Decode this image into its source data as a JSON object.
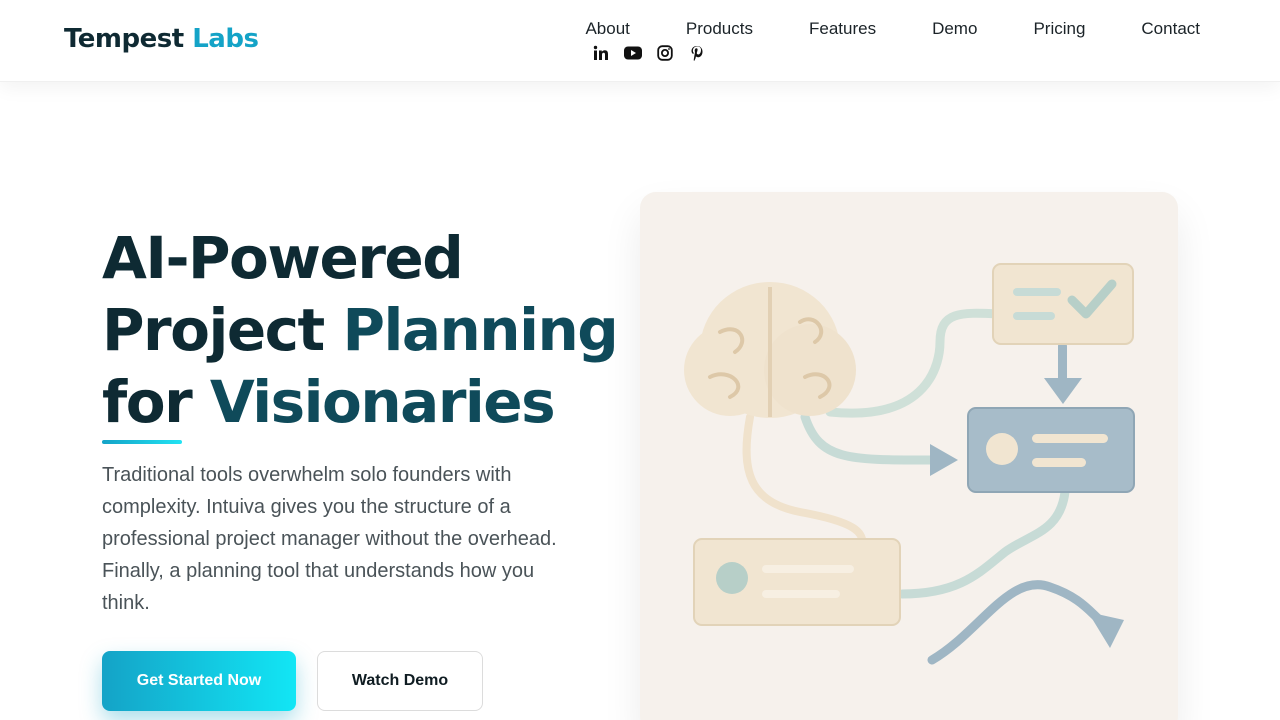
{
  "brand": {
    "name_part1": "Tempest",
    "name_part2": "Labs"
  },
  "nav": {
    "items": [
      {
        "label": "About"
      },
      {
        "label": "Products"
      },
      {
        "label": "Features"
      },
      {
        "label": "Demo"
      },
      {
        "label": "Pricing"
      },
      {
        "label": "Contact"
      }
    ]
  },
  "socials": [
    "linkedin-icon",
    "youtube-icon",
    "instagram-icon",
    "pinterest-icon"
  ],
  "hero": {
    "title_line1": "AI-Powered",
    "title_line2a": "Project ",
    "title_line2b": "Planning",
    "title_line3a": "for ",
    "title_line3b": "Visionaries",
    "description": "Traditional tools overwhelm solo founders with complexity. Intuiva gives you the structure of a professional project manager without the overhead. Finally, a planning tool that understands how you think.",
    "cta_primary": "Get Started Now",
    "cta_secondary": "Watch Demo"
  },
  "colors": {
    "accent": "#14a3c7",
    "accent_light": "#12e6f5",
    "heading": "#0e2a33",
    "card_bg": "#f6f1ec"
  }
}
